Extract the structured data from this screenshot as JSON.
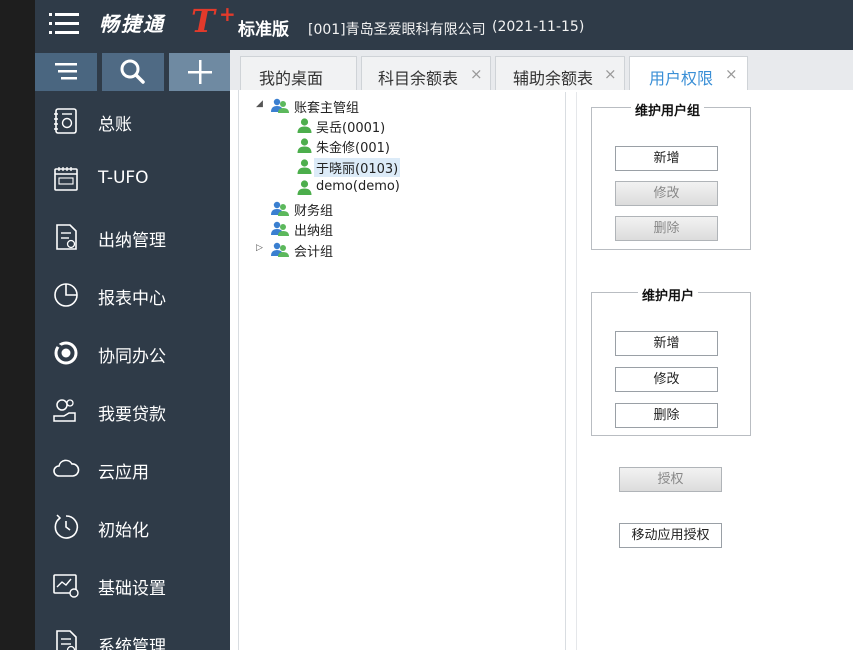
{
  "header": {
    "brand_name": "畅捷通",
    "brand_t": "T",
    "brand_plus": "+",
    "edition": "标准版",
    "company": "[001]青岛圣爱眼科有限公司",
    "date": "(2021-11-15)"
  },
  "toolbar_icons": [
    "list-icon",
    "search-icon",
    "plus-icon"
  ],
  "sidebar": {
    "items": [
      {
        "label": "总账",
        "icon": "ledger-icon"
      },
      {
        "label": "T-UFO",
        "icon": "tufo-icon"
      },
      {
        "label": "出纳管理",
        "icon": "cashier-document-icon"
      },
      {
        "label": "报表中心",
        "icon": "pie-chart-icon"
      },
      {
        "label": "协同办公",
        "icon": "collaboration-icon"
      },
      {
        "label": "我要贷款",
        "icon": "loan-icon"
      },
      {
        "label": "云应用",
        "icon": "cloud-icon"
      },
      {
        "label": "初始化",
        "icon": "clock-refresh-icon"
      },
      {
        "label": "基础设置",
        "icon": "settings-chart-icon"
      },
      {
        "label": "系统管理",
        "icon": "system-document-icon"
      }
    ]
  },
  "tabs": [
    {
      "label": "我的桌面",
      "closable": false,
      "active": false
    },
    {
      "label": "科目余额表",
      "closable": true,
      "active": false,
      "close": "×"
    },
    {
      "label": "辅助余额表",
      "closable": true,
      "active": false,
      "close": "×"
    },
    {
      "label": "用户权限",
      "closable": true,
      "active": true,
      "close": "×"
    }
  ],
  "tree": {
    "groups": [
      {
        "label": "账套主管组",
        "expanded": true,
        "expander": "◢",
        "users": [
          "吴岳(0001)",
          "朱金修(001)",
          "于晓丽(0103)",
          "demo(demo)"
        ],
        "selected_user": "于晓丽(0103)"
      },
      {
        "label": "财务组"
      },
      {
        "label": "出纳组"
      },
      {
        "label": "会计组",
        "collapsed_expander": "▷"
      }
    ]
  },
  "user_group_panel": {
    "title": "维护用户组",
    "add": "新增",
    "edit": "修改",
    "delete": "删除"
  },
  "user_panel": {
    "title": "维护用户",
    "add": "新增",
    "edit": "修改",
    "delete": "删除"
  },
  "authorize_button": "授权",
  "mobile_authorize_button": "移动应用授权",
  "colors": {
    "header_bg": "#2f3b48",
    "sidebar_bg": "#2f3b48",
    "active_tab_text": "#3a8fd6",
    "brand_red": "#e23a2b"
  }
}
